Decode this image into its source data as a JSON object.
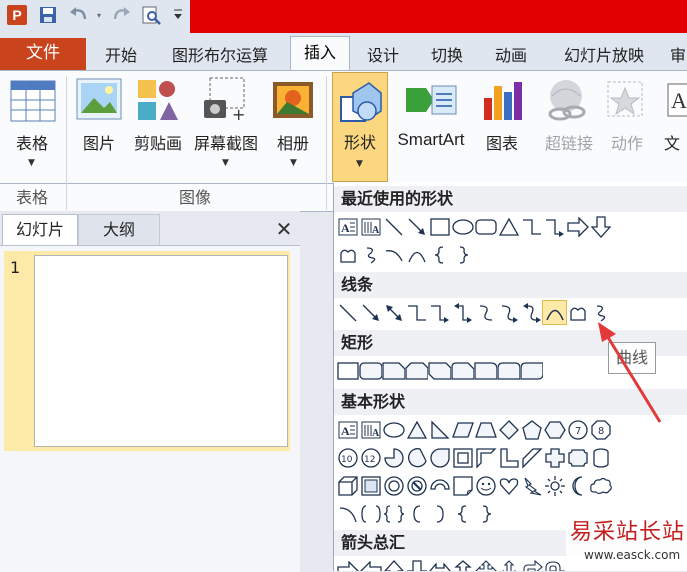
{
  "title_bar": {
    "app_icon": "P",
    "quick_access": [
      "save-icon",
      "undo-icon",
      "redo-icon",
      "print-preview-icon",
      "customize-icon"
    ]
  },
  "tabs": {
    "file": "文件",
    "items": [
      "开始",
      "图形布尔运算",
      "插入",
      "设计",
      "切换",
      "动画",
      "幻灯片放映",
      "审"
    ],
    "active": "插入"
  },
  "ribbon": {
    "table_button": "表格",
    "table_group": "表格",
    "picture_button": "图片",
    "clipart_button": "剪贴画",
    "screenshot_button": "屏幕截图",
    "album_button": "相册",
    "images_group": "图像",
    "shapes_button": "形状",
    "smartart_button": "SmartArt",
    "chart_button": "图表",
    "hyperlink_button": "超链接",
    "action_button": "动作",
    "text_button": "文"
  },
  "left_pane": {
    "slides_tab": "幻灯片",
    "outline_tab": "大纲",
    "close": "✕",
    "slide_number": "1"
  },
  "gallery": {
    "sections": [
      "最近使用的形状",
      "线条",
      "矩形",
      "基本形状",
      "箭头总汇"
    ],
    "tooltip": "曲线"
  },
  "watermark": {
    "text": "易采站长站",
    "url": "www.easck.com"
  },
  "colors": {
    "file_tab": "#c9431c",
    "title_bar_redaction": "#e10000",
    "hover_yellow": "#fde9a8",
    "shape_stroke": "#1f3350"
  }
}
